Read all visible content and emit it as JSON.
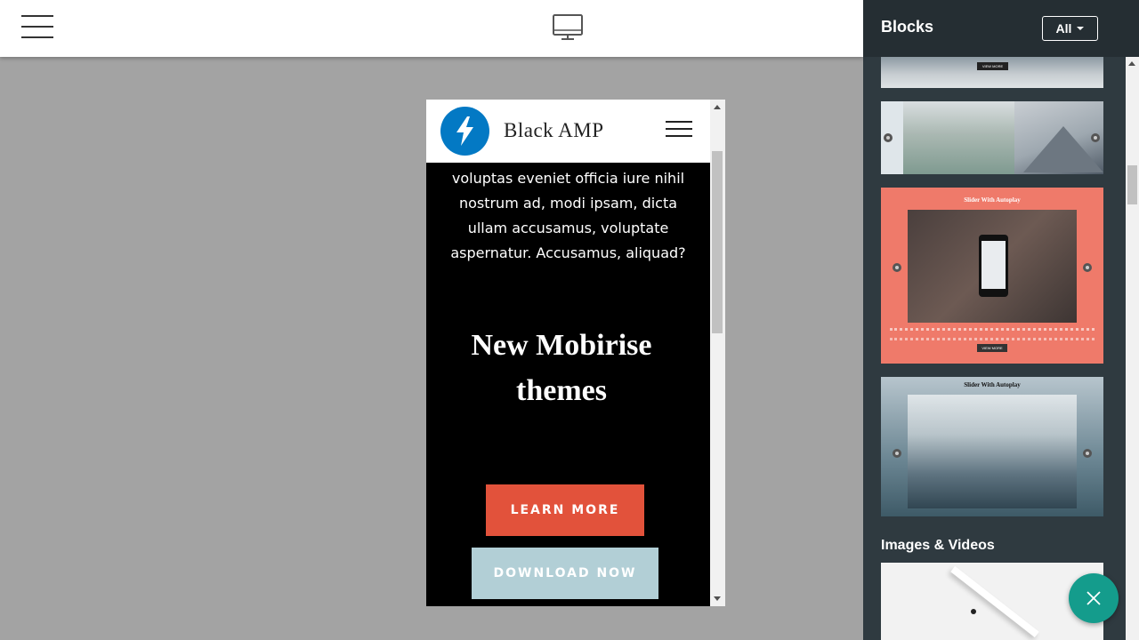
{
  "topbar": {
    "menu_icon": "hamburger-menu-icon",
    "device_icon": "desktop-monitor-icon"
  },
  "preview": {
    "brand": "Black AMP",
    "logo_icon": "lightning-bolt-icon",
    "menu_icon": "hamburger-menu-icon",
    "paragraph": "voluptas eveniet officia iure nihil nostrum ad, modi ipsam, dicta ullam accusamus, voluptate aspernatur. Accusamus, aliquad?",
    "hero_title": "New Mobirise themes",
    "learn_more": "LEARN MORE",
    "download_now": "DOWNLOAD NOW"
  },
  "panel": {
    "title": "Blocks",
    "filter_label": "All",
    "thumbs": {
      "view_more": "VIEW MORE",
      "slider_title_1": "Slider With Autoplay",
      "slider_title_2": "Slider With Autoplay"
    },
    "section_images": "Images & Videos"
  },
  "fab": {
    "icon": "close-icon",
    "color": "#149c8c"
  },
  "colors": {
    "learn_more_bg": "#e2523b",
    "download_bg": "#b2cfd6",
    "logo_bg": "#0379c4",
    "panel_bg": "#2f3a40"
  }
}
